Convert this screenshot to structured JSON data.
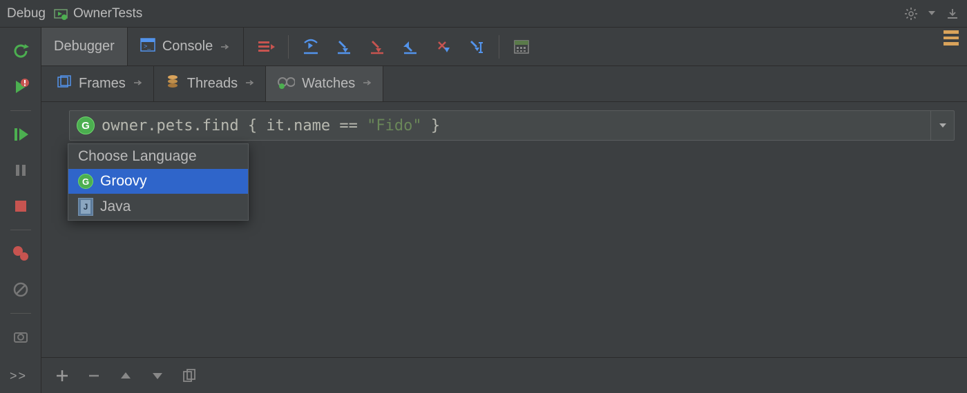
{
  "title": {
    "tool_window": "Debug",
    "run_config": "OwnerTests"
  },
  "tabs": {
    "debugger": "Debugger",
    "console": "Console"
  },
  "subtabs": {
    "frames": "Frames",
    "threads": "Threads",
    "watches": "Watches"
  },
  "watch": {
    "expression_plain": "owner.pets.find { it.name == \"Fido\" }",
    "expr_prefix": "owner.pets.find { it.name == ",
    "expr_string": "\"Fido\"",
    "expr_suffix": " }",
    "lang_badge": "G"
  },
  "lang_popup": {
    "title": "Choose Language",
    "items": [
      {
        "label": "Groovy",
        "badge": "G",
        "selected": true
      },
      {
        "label": "Java",
        "badge": "J",
        "selected": false
      }
    ]
  },
  "expand_handle": ">>",
  "colors": {
    "background": "#3c3f41",
    "selection": "#2f65ca",
    "groovy_green": "#4caf50",
    "string_green": "#6a8759",
    "orange": "#d9a35b"
  }
}
